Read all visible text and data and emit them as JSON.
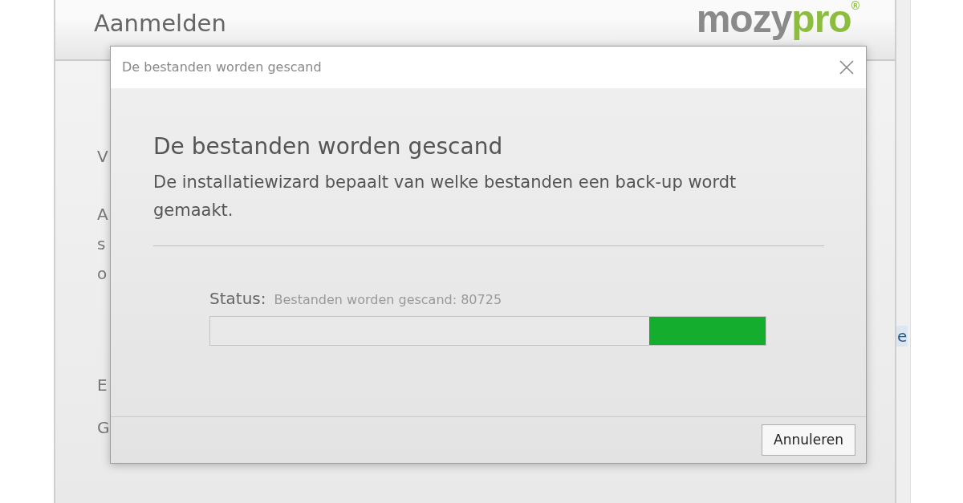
{
  "background_window": {
    "title": "Aanmelden",
    "logo": {
      "part_1": "mozy",
      "part_2": "pro",
      "mark": "®"
    },
    "left_fragments": [
      "V",
      "A",
      "s",
      "o",
      "E",
      "G"
    ],
    "right_fragments": [
      "e"
    ]
  },
  "dialog": {
    "title": "De bestanden worden gescand",
    "heading": "De bestanden worden gescand",
    "description": "De installatiewizard bepaalt van welke bestanden een back-up wordt gemaakt.",
    "status_label": "Status:",
    "status_value": "Bestanden worden gescand: 80725",
    "progress": {
      "level": 0.21
    },
    "buttons": [
      "Annuleren"
    ]
  }
}
